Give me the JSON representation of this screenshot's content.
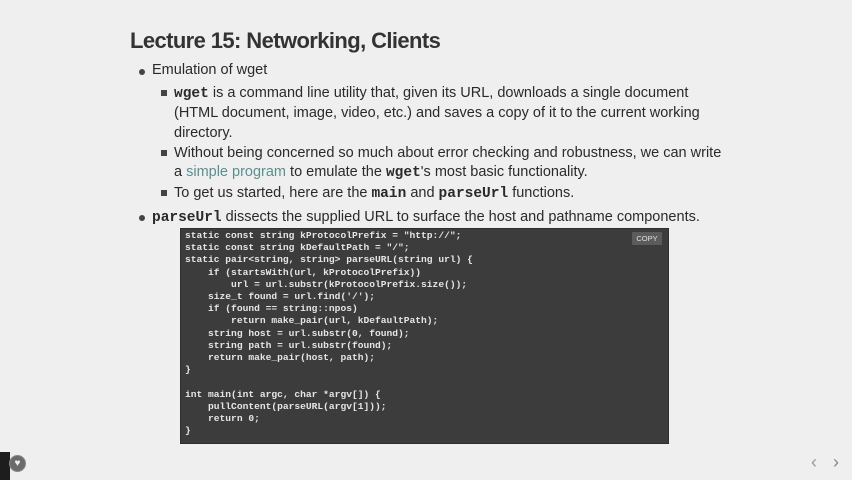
{
  "title": "Lecture 15: Networking, Clients",
  "bullets": {
    "emulation": "Emulation of wget",
    "wget_cmd": "wget",
    "wget_desc_1": " is a command line utility that, given its URL, downloads a single document",
    "wget_desc_2": "(HTML document, image, video, etc.) and saves a copy of it to the current working",
    "wget_desc_3": "directory.",
    "concern_1": "Without being concerned so much about error checking and robustness, we can write",
    "concern_2a": "a ",
    "concern_link": "simple program",
    "concern_2b": " to emulate the ",
    "concern_wget": "wget",
    "concern_2c": "'s most basic functionality.",
    "start_a": "To get us started, here are the ",
    "start_main": "main",
    "start_b": " and ",
    "start_parse": "parseUrl",
    "start_c": " functions.",
    "parse_cmd": "parseUrl",
    "parse_desc": " dissects the supplied URL to surface the host and pathname components."
  },
  "code": {
    "copy_label": "COPY",
    "lines": [
      "static const string kProtocolPrefix = \"http://\";",
      "static const string kDefaultPath = \"/\";",
      "static pair<string, string> parseURL(string url) {",
      "    if (startsWith(url, kProtocolPrefix))",
      "        url = url.substr(kProtocolPrefix.size());",
      "    size_t found = url.find('/');",
      "    if (found == string::npos)",
      "        return make_pair(url, kDefaultPath);",
      "    string host = url.substr(0, found);",
      "    string path = url.substr(found);",
      "    return make_pair(host, path);",
      "}",
      "",
      "int main(int argc, char *argv[]) {",
      "    pullContent(parseURL(argv[1]));",
      "    return 0;",
      "}"
    ]
  },
  "nav": {
    "prev_icon": "chevron-left-icon",
    "next_icon": "chevron-right-icon",
    "prev_glyph": "‹",
    "next_glyph": "›"
  },
  "player_icon": "heart-icon",
  "player_glyph": "♥"
}
